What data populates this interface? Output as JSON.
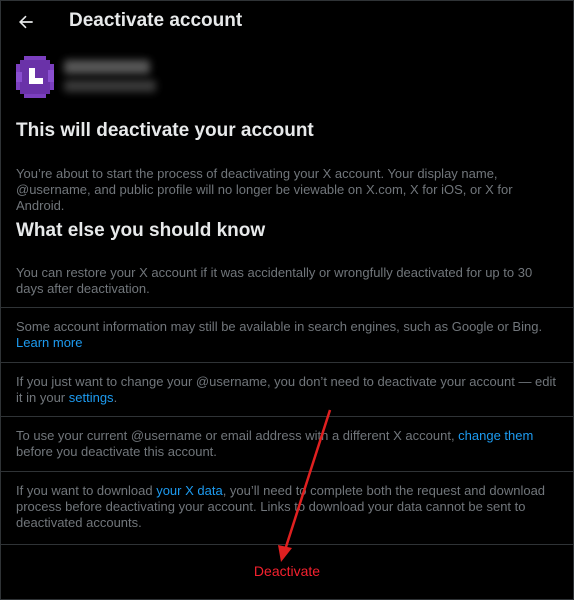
{
  "header": {
    "title": "Deactivate account",
    "back_icon": "arrow-left-icon"
  },
  "account": {
    "avatar_color": "#7b3fbf"
  },
  "main": {
    "heading": "This will deactivate your account",
    "description": "You’re about to start the process of deactivating your X account. Your display name, @username, and public profile will no longer be viewable on X.com, X for iOS, or X for Android.",
    "subheading": "What else you should know"
  },
  "info": {
    "restore": "You can restore your X account if it was accidentally or wrongfully deactivated for up to 30 days after deactivation.",
    "search_text": "Some account information may still be available in search engines, such as Google or Bing.",
    "learn_more": "Learn more",
    "username_text_pre": "If you just want to change your @username, you don’t need to deactivate your account — edit it in your ",
    "settings_link": "settings",
    "username_text_post": ".",
    "email_text_pre": "To use your current @username or email address with a different X account, ",
    "change_them_link": "change them",
    "email_text_post": " before you deactivate this account.",
    "download_text_pre": "If you want to download ",
    "your_x_data_link": "your X data",
    "download_text_post": ", you’ll need to complete both the request and download process before deactivating your account. Links to download your data cannot be sent to deactivated accounts."
  },
  "actions": {
    "deactivate_label": "Deactivate"
  },
  "colors": {
    "background": "#000000",
    "text": "#e7e9ea",
    "muted": "#71767b",
    "link": "#1d9bf0",
    "danger": "#f4212e",
    "divider": "#2f3336",
    "annotation_arrow": "#e02020"
  }
}
